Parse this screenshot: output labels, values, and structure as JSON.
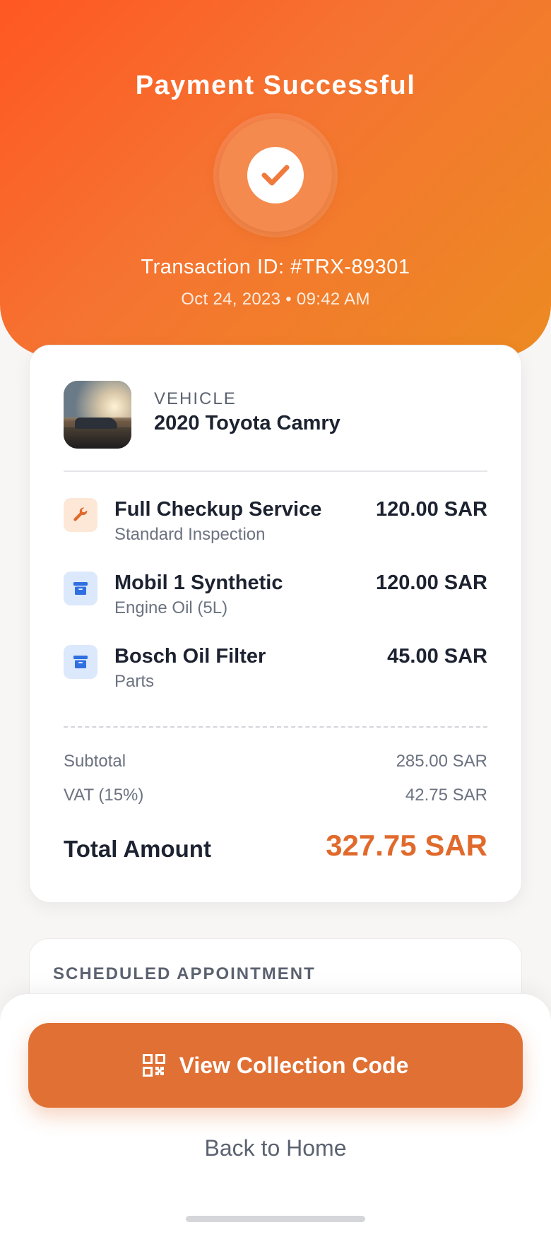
{
  "header": {
    "title": "Payment Successful",
    "transaction_id": "Transaction ID: #TRX-89301",
    "datetime": "Oct 24, 2023 • 09:42 AM"
  },
  "vehicle": {
    "label": "VEHICLE",
    "name": "2020 Toyota Camry"
  },
  "items": [
    {
      "name": "Full Checkup Service",
      "subtitle": "Standard Inspection",
      "price": "120.00 SAR",
      "icon": "wrench-icon"
    },
    {
      "name": "Mobil 1 Synthetic",
      "subtitle": "Engine Oil (5L)",
      "price": "120.00 SAR",
      "icon": "archive-box-icon"
    },
    {
      "name": "Bosch Oil Filter",
      "subtitle": "Parts",
      "price": "45.00 SAR",
      "icon": "archive-box-icon"
    }
  ],
  "summary": {
    "subtotal_label": "Subtotal",
    "subtotal_value": "285.00 SAR",
    "vat_label": "VAT (15%)",
    "vat_value": "42.75 SAR",
    "total_label": "Total Amount",
    "total_value": "327.75 SAR"
  },
  "appointment": {
    "title": "SCHEDULED APPOINTMENT"
  },
  "actions": {
    "primary_label": "View Collection Code",
    "primary_icon": "qr-code-icon",
    "secondary_label": "Back to Home"
  },
  "colors": {
    "accent": "#e07034",
    "header_gradient_start": "#ff5722",
    "header_gradient_end": "#ec8a22"
  }
}
